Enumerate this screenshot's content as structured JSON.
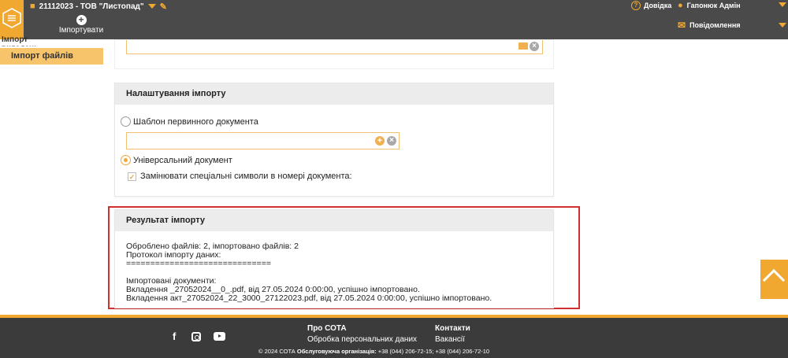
{
  "header": {
    "company": "21112023 - ТОВ \"Листопад\"",
    "import_button": "Імпортувати",
    "help": "Довідка",
    "user": "Гапонюк Адмін",
    "notifications": "Повідомлення"
  },
  "sidebar": {
    "section": "Імпорт вкладень",
    "items": [
      {
        "label": "Імпорт файлів",
        "active": true
      }
    ]
  },
  "settings": {
    "title": "Налаштування імпорту",
    "option_template": "Шаблон первинного документа",
    "option_universal": "Універсальний документ",
    "replace_symbols": "Замінювати спеціальні символи в номері документа:",
    "selected": "universal",
    "replace_checked": true
  },
  "result": {
    "title": "Результат імпорту",
    "lines": [
      "Оброблено файлів: 2, імпортовано файлів: 2",
      "Протокол імпорту даних:",
      "==============================",
      "",
      "Імпортовані документи:",
      "Вкладення _27052024__0_.pdf, від 27.05.2024 0:00:00, успішно імпортовано.",
      "Вкладення акт_27052024_22_3000_27122023.pdf, від 27.05.2024 0:00:00, успішно імпортовано."
    ]
  },
  "footer": {
    "col1_title": "Про СОТА",
    "col1_link": "Обробка персональних даних",
    "col2_title": "Контакти",
    "col2_link": "Вакансії",
    "copyright": "© 2024 СОТА",
    "org_label": "Обслуговуюча організація:",
    "phones": "+38 (044) 206-72-15; +38 (044) 206-72-10"
  },
  "colors": {
    "accent": "#f0a830",
    "topbar": "#4a4a4a",
    "footer": "#3b3b3b",
    "highlight_border": "#d03030"
  }
}
